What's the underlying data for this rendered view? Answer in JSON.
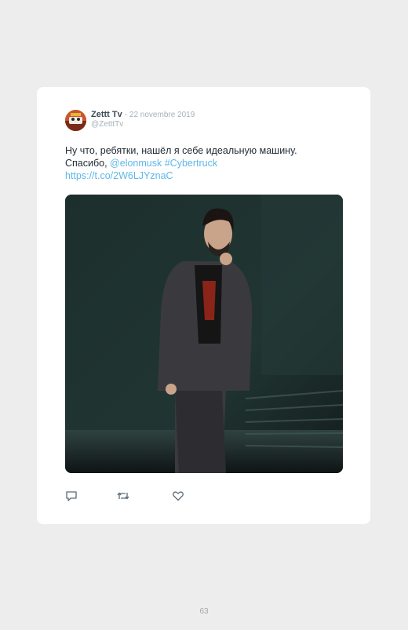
{
  "tweet": {
    "author_name": "Zettt Tv",
    "date": "- 22 novembre 2019",
    "handle": "@ZetttTv",
    "text_line1": "Ну что, ребятки, нашёл я себе идеальную машину.",
    "text_line2_prefix": "Спасибо, ",
    "mention": "@elonmusk",
    "hashtag": "#Cybertruck",
    "link": "https://t.co/2W6LJYznaC"
  },
  "icons": {
    "reply": "reply-icon",
    "retweet": "retweet-icon",
    "like": "like-icon"
  },
  "colors": {
    "link": "#5fb7e8",
    "card": "#ffffff",
    "page": "#ecedec"
  },
  "page_number": "63"
}
